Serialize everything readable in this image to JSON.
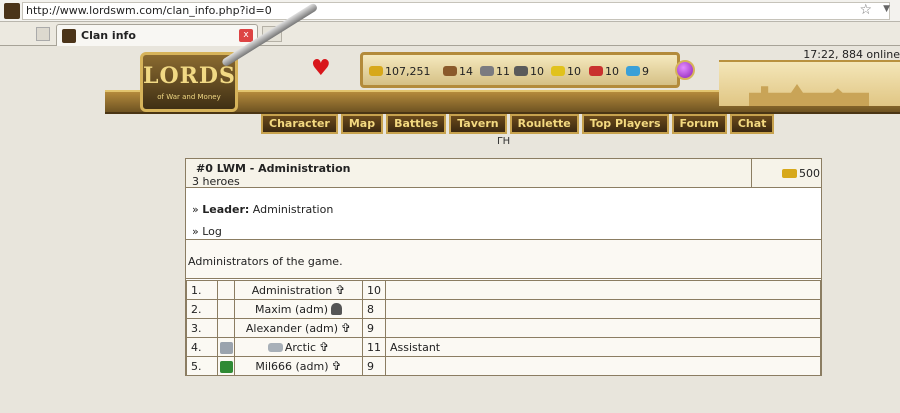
{
  "browser": {
    "url": "http://www.lordswm.com/clan_info.php?id=0",
    "tab_title": "Clan info",
    "tab_close_label": "x",
    "new_tab_label": "+"
  },
  "header": {
    "logo_word": "LORDS",
    "logo_tagline": "of War and Money",
    "time_online": "17:22, 884 online",
    "sub_label": "ΓΗ",
    "resources": [
      {
        "icon": "gold-icon",
        "value": "107,251",
        "color": "#d7a81a"
      },
      {
        "icon": "wood-icon",
        "value": "14",
        "color": "#8a5a2b"
      },
      {
        "icon": "ore-icon",
        "value": "11",
        "color": "#7b7b80"
      },
      {
        "icon": "mercury-icon",
        "value": "10",
        "color": "#5a5a5a"
      },
      {
        "icon": "sulfur-icon",
        "value": "10",
        "color": "#e1c21c"
      },
      {
        "icon": "crystal-icon",
        "value": "10",
        "color": "#c9312e"
      },
      {
        "icon": "gems-icon",
        "value": "9",
        "color": "#3aa0d8"
      }
    ],
    "menu": [
      "Character",
      "Map",
      "Battles",
      "Tavern",
      "Roulette",
      "Top Players",
      "Forum",
      "Chat"
    ]
  },
  "clan": {
    "title": "#0 LWM - Administration",
    "heroes": "3 heroes",
    "gold": "500",
    "leader_label": "Leader:",
    "leader_name": "Administration",
    "log_label": "Log",
    "description": "Administrators of the game.",
    "members": [
      {
        "num": "1.",
        "name": "Administration",
        "level": "10",
        "status": "",
        "badge": "",
        "rank": "cross"
      },
      {
        "num": "2.",
        "name": "Maxim (adm)",
        "level": "8",
        "status": "",
        "badge": "",
        "rank": "helmet"
      },
      {
        "num": "3.",
        "name": "Alexander (adm)",
        "level": "9",
        "status": "",
        "badge": "",
        "rank": "cross"
      },
      {
        "num": "4.",
        "name": "Arctic",
        "level": "11",
        "status": "Assistant",
        "badge": "grey",
        "rank": "cross"
      },
      {
        "num": "5.",
        "name": "Mil666 (adm)",
        "level": "9",
        "status": "",
        "badge": "green",
        "rank": "cross"
      }
    ]
  }
}
